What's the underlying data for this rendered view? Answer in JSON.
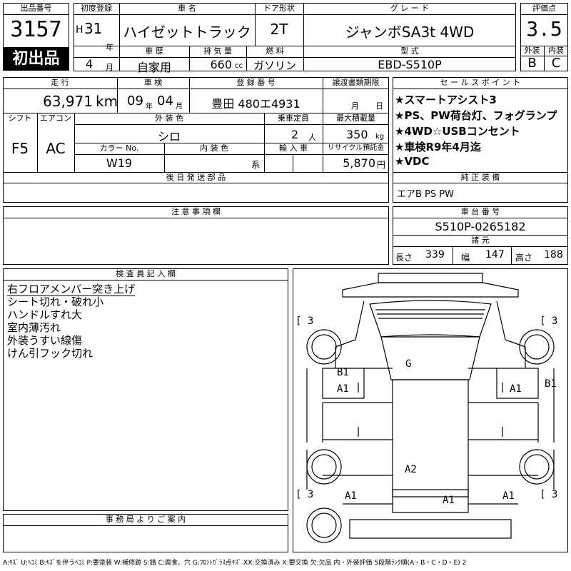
{
  "header": {
    "lot_label": "出品番号",
    "lot_number": "3157",
    "first_listing_badge": "初出品",
    "first_reg_label": "初度登録",
    "era": "H",
    "year_num": "31",
    "year_unit": "年",
    "month_num": "4",
    "month_unit": "月",
    "model_label": "車 名",
    "model_name": "ハイゼットトラック",
    "door_label": "ドア形状",
    "door_type": "2T",
    "grade_label": "グ レ ー ド",
    "grade_name": "ジャンボSA3t 4WD",
    "history_label": "車 歴",
    "history_value": "自家用",
    "displacement_label": "排 気 量",
    "displacement_value": "660",
    "displacement_unit": "cc",
    "fuel_label": "燃 料",
    "fuel_value": "ガソリン",
    "type_label": "型 式",
    "type_value": "EBD-S510P",
    "score_label": "評価点",
    "score_value": "3.5",
    "exterior_label": "外装",
    "exterior_grade": "B",
    "interior_label": "内装",
    "interior_grade": "C"
  },
  "specs": {
    "mileage_label": "走 行",
    "mileage_value": "63,971",
    "mileage_unit": "km",
    "inspection_label": "車 検",
    "inspection_year": "09",
    "inspection_year_unit": "年",
    "inspection_month": "04",
    "inspection_month_unit": "月",
    "plate_label": "登 録 番 号",
    "plate_value": "豊田 480エ4931",
    "transfer_label": "譲渡書類期限",
    "transfer_month_unit": "月",
    "transfer_day_unit": "日",
    "shift_label": "シフト",
    "shift_value": "F5",
    "ac_label": "エアコン",
    "ac_value": "AC",
    "exterior_color_label": "外 装 色",
    "exterior_color_value": "シロ",
    "capacity_label": "乗車定員",
    "capacity_value": "2",
    "capacity_unit": "人",
    "load_label": "最大積載量",
    "load_value": "350",
    "load_unit": "kg",
    "color_no_label": "カラー No.",
    "color_no_value": "W19",
    "interior_color_label": "内 装 色",
    "interior_color_value": "系",
    "import_label": "輸 入 車",
    "recycle_label": "リサイクル預託金",
    "recycle_value": "5,870",
    "recycle_unit": "円",
    "later_parts_label": "後 日 発 送 部 品"
  },
  "sales_points": {
    "label": "セ ー ル ス ポ イ ン ト",
    "items": [
      "★スマートアシスト3",
      "★PS、PW荷台灯、フォグランプ",
      "★4WD☆USBコンセント",
      "★車検R9年4月迄",
      "★VDC"
    ]
  },
  "equipment": {
    "label": "純 正 装 備",
    "value": "エアB PS PW"
  },
  "caution": {
    "label": "注 意 事 項 欄"
  },
  "chassis": {
    "label": "車 台 番 号",
    "value": "S510P-0265182",
    "dims_label": "諸 元",
    "length_label": "長さ",
    "length_value": "339",
    "width_label": "幅",
    "width_value": "147",
    "height_label": "高さ",
    "height_value": "188"
  },
  "inspector": {
    "label": "検 査 員 記 入 欄",
    "notes": [
      "右フロアメンバー突き上げ",
      "シート切れ・破れ小",
      "ハンドルすれ大",
      "室内薄汚れ",
      "外装うすい線傷",
      "けん引フック切れ"
    ]
  },
  "office": {
    "label": "事 務 局 よ り ご 案 内"
  },
  "diagram": {
    "tire_labels": [
      "[ 3",
      "[ 3",
      "[ 3",
      "[ 3"
    ],
    "damage_marks": [
      "G",
      "B1",
      "A1",
      "A1",
      "B1",
      "A2",
      "A1",
      "A1",
      "A1"
    ]
  },
  "legend": "A:ｷｽﾞ U:ﾍｺﾐ B:ｷｽﾞを伴うﾍｺﾐ P:要塗装 W:補修跡 S:錆 C:腐食、穴 G:ﾌﾛﾝﾄｶﾞﾗｽ点ｷｽﾞ XX:交換済み X:要交換 欠:欠品 内・外装評価 5段階ﾗﾝｸ順(A・B・C・D・E) 2"
}
